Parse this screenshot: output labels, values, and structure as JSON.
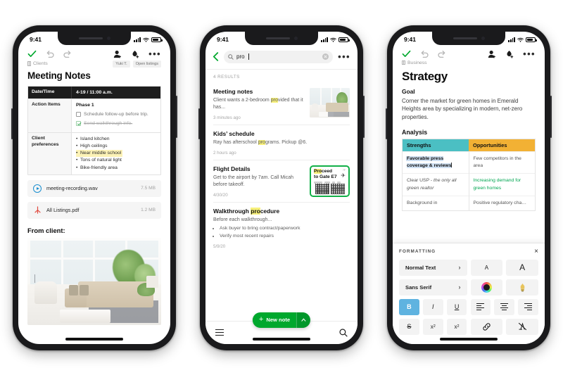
{
  "phone1": {
    "status": {
      "time": "9:41"
    },
    "toolbar": {
      "check": "check-icon",
      "undo": "undo-icon",
      "redo": "redo-icon",
      "add_person": "add-person-icon",
      "add_tag": "add-tag-icon",
      "more": "•••"
    },
    "breadcrumb": "Clients",
    "tags": [
      "Yuki T.",
      "Open listings"
    ],
    "note_title": "Meeting Notes",
    "table": {
      "rows": [
        {
          "label": "Date/Time",
          "value": "4-19 / 11:00 a.m."
        }
      ],
      "action_label": "Action Items",
      "phase": "Phase 1",
      "todos": [
        {
          "text": "Schedule follow-up before trip.",
          "done": false
        },
        {
          "text": "Send walkthrough info.",
          "done": true
        }
      ],
      "prefs_label": "Client preferences",
      "prefs": [
        {
          "text": "Island kitchen",
          "highlight": false
        },
        {
          "text": "High ceilings",
          "highlight": false
        },
        {
          "text": "Near middle school",
          "highlight": true
        },
        {
          "text": "Tons of natural light",
          "highlight": false
        },
        {
          "text": "Bike-friendly area",
          "highlight": false
        }
      ]
    },
    "attachments": [
      {
        "icon": "audio-play-icon",
        "name": "meeting-recording.wav",
        "size": "7.5 MB"
      },
      {
        "icon": "pdf-icon",
        "name": "All Listings.pdf",
        "size": "1.2 MB"
      }
    ],
    "from_client": "From client:",
    "photo_alt": "living-room-photo"
  },
  "phone2": {
    "status": {
      "time": "9:41"
    },
    "search": {
      "query": "pro",
      "back": "back-chevron-icon",
      "search_icon": "search-icon",
      "clear": "clear-icon",
      "more": "•••"
    },
    "result_count": "4 RESULTS",
    "results": [
      {
        "title": "Meeting notes",
        "snippet_pre": "Client wants a 2-bedroom ",
        "snippet_hl": "pro",
        "snippet_post": "vided that it has...",
        "date": "3 minutes ago",
        "thumb": "living-room-thumbnail"
      },
      {
        "title": "Kids’ schedule",
        "snippet_pre": "Ray has afterschool ",
        "snippet_hl": "pro",
        "snippet_post": "grams. Pickup @6.",
        "date": "2 hours ago",
        "thumb": null
      },
      {
        "title": "Flight Details",
        "snippet_pre": "Get to the airport by 7am. Call Micah before takeoff.",
        "snippet_hl": "",
        "snippet_post": "",
        "date": "4/30/20",
        "thumb": "boarding-pass-thumbnail",
        "boarding_pass": {
          "line1_hl": "Pro",
          "line1_rest": "ceed",
          "line2": "to Gate E7",
          "corner": "7F"
        }
      },
      {
        "title_pre": "Walkthrough ",
        "title_hl": "pro",
        "title_post": "cedure",
        "title": "Walkthrough procedure",
        "snippet_pre": "Before each walkthrough...",
        "bullets": [
          "Ask buyer to bring contract/paperwork",
          "Verify most recent repairs"
        ],
        "date": "5/9/20",
        "thumb": null
      }
    ],
    "bottom": {
      "menu_icon": "hamburger-menu-icon",
      "new_note": "New note",
      "new_note_plus": "+",
      "new_note_caret": "∧",
      "search_icon": "search-icon"
    }
  },
  "phone3": {
    "status": {
      "time": "9:41"
    },
    "toolbar": {
      "check": "check-icon",
      "undo": "undo-icon",
      "redo": "redo-icon",
      "add_person": "add-person-icon",
      "add_tag": "add-tag-icon",
      "more": "•••"
    },
    "breadcrumb": "Business",
    "doc_title": "Strategy",
    "goal_heading": "Goal",
    "goal_body": "Corner the market for green homes in Emerald Heights area by specializing in modern, net-zero properties.",
    "analysis_heading": "Analysis",
    "swot": {
      "headers": [
        {
          "label": "Strengths",
          "color": "#4BBFC3"
        },
        {
          "label": "Opportunities",
          "color": "#F2B134"
        }
      ],
      "rows": [
        {
          "strength_text": "Favorable press coverage & reviews",
          "strength_selected": true,
          "opportunity_text": "Few competitors in the area",
          "opportunity_green": false
        },
        {
          "strength_pre": "Clear USP - ",
          "strength_em": "the only all green realtor",
          "strength_selected": false,
          "opportunity_text": "Increasing demand for green homes",
          "opportunity_green": true
        },
        {
          "strength_text": "Background in",
          "strength_selected": false,
          "opportunity_text": "Positive regulatory cha…",
          "opportunity_green": false
        }
      ]
    },
    "formatting": {
      "title": "FORMATTING",
      "close": "×",
      "style_select": "Normal Text",
      "font_select": "Sans Serif",
      "chevron": "›",
      "buttons": {
        "font_small": "A",
        "font_large": "A",
        "color_wheel": "color-wheel-icon",
        "highlighter": "highlighter-icon",
        "bold": "B",
        "italic": "I",
        "underline": "U",
        "align_left": "align-left-icon",
        "align_center": "align-center-icon",
        "align_right": "align-right-icon",
        "strikethrough": "S",
        "superscript": "x",
        "superscript_sup": "2",
        "subscript": "x",
        "subscript_sub": "2",
        "link": "link-icon",
        "clear_format": "clear-formatting-icon"
      },
      "active": "bold"
    }
  },
  "theme": {
    "brand_green": "#00a82d",
    "highlight_yellow": "#fcf2b6",
    "search_highlight": "#f7f07a",
    "teal": "#4BBFC3",
    "amber": "#F2B134",
    "selection_blue": "#cfe0f2",
    "active_blue": "#5fb3e0"
  }
}
